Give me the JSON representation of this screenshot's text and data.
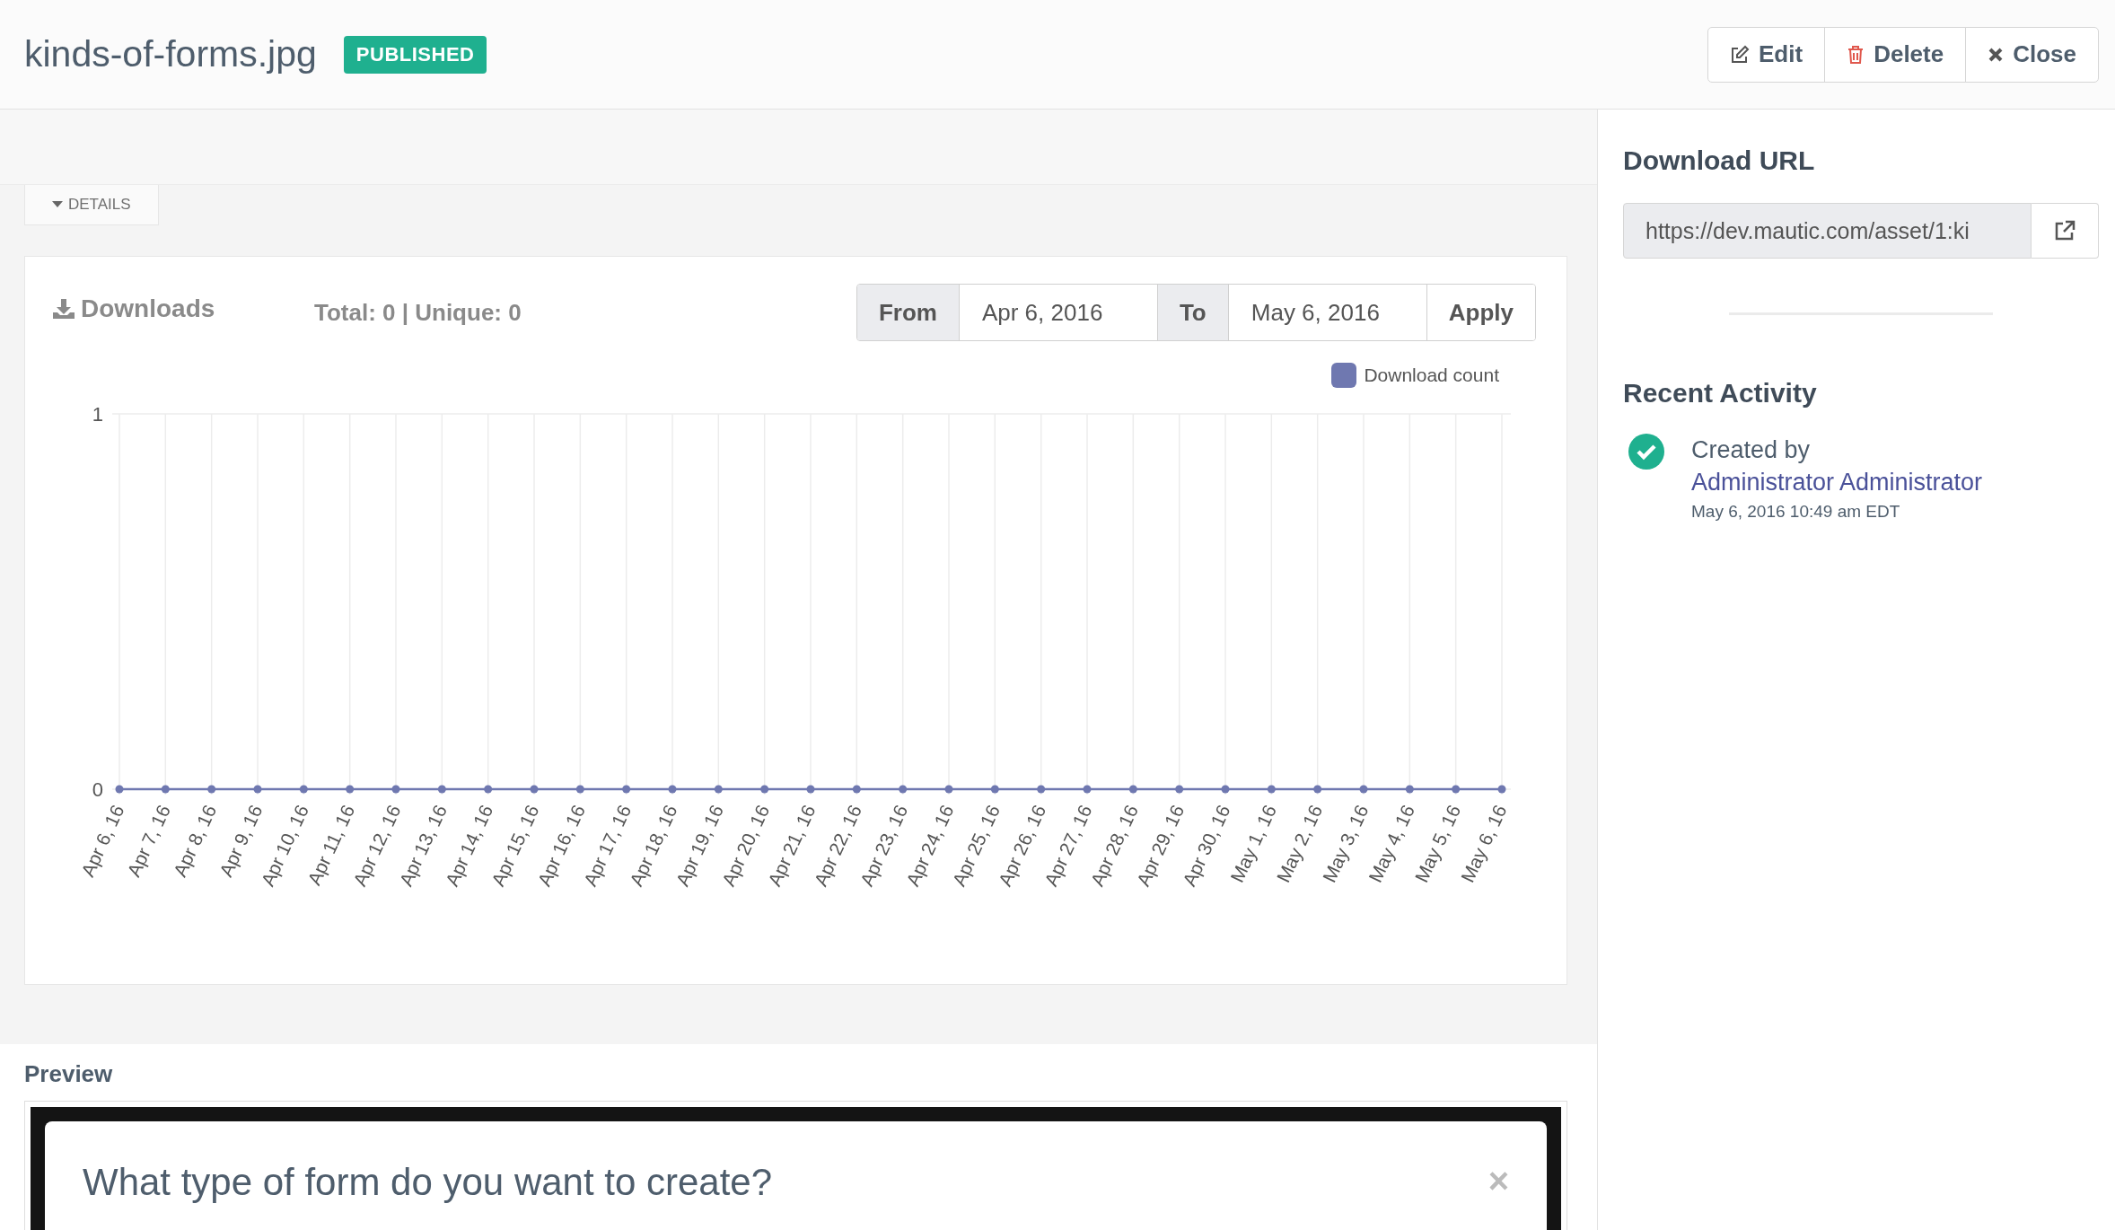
{
  "header": {
    "title": "kinds-of-forms.jpg",
    "status": {
      "label": "PUBLISHED",
      "kind": "published"
    },
    "actions": [
      {
        "label": "Edit",
        "kind": "edit"
      },
      {
        "label": "Delete",
        "kind": "delete"
      },
      {
        "label": "Close",
        "kind": "close"
      }
    ]
  },
  "details_toggle": {
    "label": "DETAILS"
  },
  "downloads": {
    "title": "Downloads",
    "summary": "Total: 0 | Unique: 0",
    "date_range": {
      "from_label": "From",
      "from_value": "Apr 6, 2016",
      "to_label": "To",
      "to_value": "May 6, 2016",
      "apply": "Apply"
    },
    "chart_data": {
      "type": "line",
      "categories": [
        "Apr 6, 16",
        "Apr 7, 16",
        "Apr 8, 16",
        "Apr 9, 16",
        "Apr 10, 16",
        "Apr 11, 16",
        "Apr 12, 16",
        "Apr 13, 16",
        "Apr 14, 16",
        "Apr 15, 16",
        "Apr 16, 16",
        "Apr 17, 16",
        "Apr 18, 16",
        "Apr 19, 16",
        "Apr 20, 16",
        "Apr 21, 16",
        "Apr 22, 16",
        "Apr 23, 16",
        "Apr 24, 16",
        "Apr 25, 16",
        "Apr 26, 16",
        "Apr 27, 16",
        "Apr 28, 16",
        "Apr 29, 16",
        "Apr 30, 16",
        "May 1, 16",
        "May 2, 16",
        "May 3, 16",
        "May 4, 16",
        "May 5, 16",
        "May 6, 16"
      ],
      "series": [
        {
          "name": "Download count",
          "color": "#6f78b0",
          "marker": true,
          "values": [
            0,
            0,
            0,
            0,
            0,
            0,
            0,
            0,
            0,
            0,
            0,
            0,
            0,
            0,
            0,
            0,
            0,
            0,
            0,
            0,
            0,
            0,
            0,
            0,
            0,
            0,
            0,
            0,
            0,
            0,
            0
          ]
        }
      ],
      "ylim": [
        0,
        1
      ],
      "yticks": [
        0,
        1
      ],
      "grid": true
    }
  },
  "preview": {
    "title": "Preview",
    "image": {
      "heading": "What type of form do you want to create?",
      "close": "×"
    }
  },
  "download_url": {
    "title": "Download URL",
    "value": "https://dev.mautic.com/asset/1:ki"
  },
  "recent_activity": {
    "title": "Recent Activity",
    "items": [
      {
        "text": "Created by",
        "author": "Administrator Administrator",
        "time": "May 6, 2016 10:49 am EDT"
      }
    ]
  }
}
